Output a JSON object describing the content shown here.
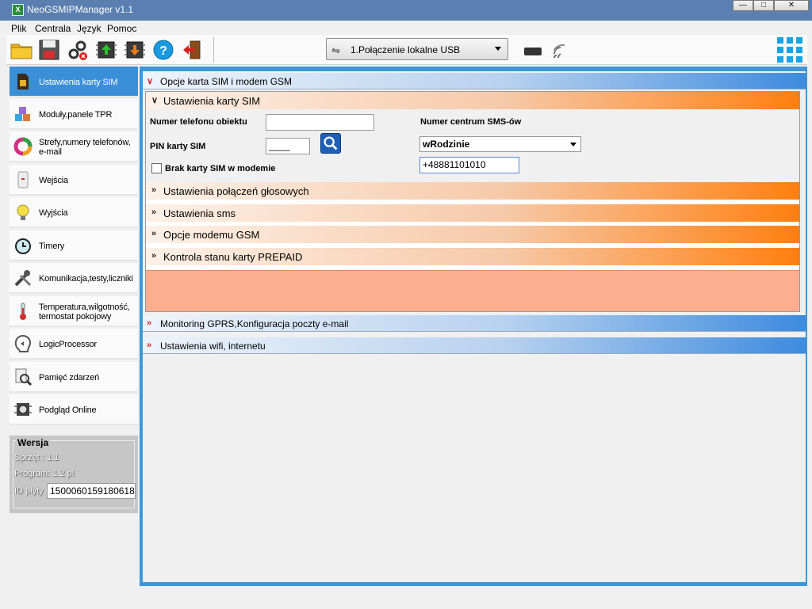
{
  "window": {
    "title": "NeoGSMIPManager v1.1",
    "icon_label": "X"
  },
  "menu": [
    "Plik",
    "Centrala",
    "Język",
    "Pomoc"
  ],
  "toolbar": {
    "icons": [
      "folder-open-icon",
      "save-icon",
      "disconnect-icon",
      "upload-to-device-icon",
      "download-from-device-icon",
      "help-icon",
      "exit-icon"
    ],
    "connection": "1.Połączenie lokalne USB",
    "help_glyph": "?"
  },
  "sidebar": {
    "items": [
      {
        "label": "Ustawienia karty SIM",
        "icon": "sim-card-icon"
      },
      {
        "label": "Moduły,panele TPR",
        "icon": "modules-cubes-icon"
      },
      {
        "label": "Strefy,numery telefonów, e-mail",
        "icon": "zones-ring-icon"
      },
      {
        "label": "Wejścia",
        "icon": "input-sensor-icon"
      },
      {
        "label": "Wyjścia",
        "icon": "output-bulb-icon"
      },
      {
        "label": "Timery",
        "icon": "alarm-clock-icon"
      },
      {
        "label": "Komunikacja,testy,liczniki",
        "icon": "tools-icon"
      },
      {
        "label": "Temperatura,wilgotność, termostat pokojowy",
        "icon": "thermometer-icon"
      },
      {
        "label": "LogicProcessor",
        "icon": "logic-processor-icon"
      },
      {
        "label": "Pamięć zdarzeń",
        "icon": "event-log-icon"
      },
      {
        "label": "Podgląd Online",
        "icon": "online-preview-icon"
      }
    ],
    "version": {
      "title": "Wersja",
      "hardware": "Sprzęt : 1.1",
      "program": "Program: 1.2 pl",
      "board_id_label": "ID płyty",
      "board_id": "1500060159180618"
    }
  },
  "main": {
    "section1": "Opcje karta SIM i modem GSM",
    "sim_header": "Ustawienia karty SIM",
    "phone_label": "Numer telefonu obiektu",
    "phone_value": "",
    "pin_label": "PIN karty SIM",
    "pin_value": "____",
    "no_sim_label": "Brak karty SIM w modemie",
    "sms_center_label": "Numer centrum SMS-ów",
    "sms_center_operator": "wRodzinie",
    "sms_center_number": "+48881101010",
    "subsections": [
      "Ustawienia połączeń głosowych",
      "Ustawienia sms",
      "Opcje modemu GSM",
      "Kontrola stanu karty PREPAID"
    ],
    "section2": "Monitoring GPRS,Konfiguracja poczty e-mail",
    "section3": "Ustawienia wifi, internetu"
  },
  "colors": {
    "accent_blue": "#3d97d8",
    "orange": "#ff7f0f",
    "chevron_red": "#d32020"
  }
}
